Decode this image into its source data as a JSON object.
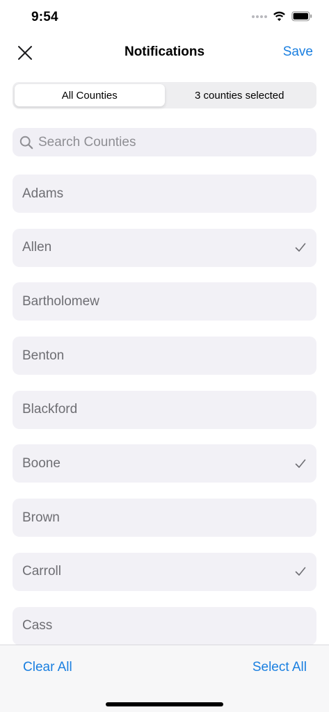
{
  "status_bar": {
    "time": "9:54"
  },
  "nav": {
    "title": "Notifications",
    "save_label": "Save"
  },
  "segmented": {
    "all_label": "All Counties",
    "selected_label": "3 counties selected",
    "active": "all"
  },
  "search": {
    "placeholder": "Search Counties",
    "value": ""
  },
  "counties": [
    {
      "name": "Adams",
      "checked": false
    },
    {
      "name": "Allen",
      "checked": true
    },
    {
      "name": "Bartholomew",
      "checked": false
    },
    {
      "name": "Benton",
      "checked": false
    },
    {
      "name": "Blackford",
      "checked": false
    },
    {
      "name": "Boone",
      "checked": true
    },
    {
      "name": "Brown",
      "checked": false
    },
    {
      "name": "Carroll",
      "checked": true
    },
    {
      "name": "Cass",
      "checked": false
    }
  ],
  "toolbar": {
    "clear_all_label": "Clear All",
    "select_all_label": "Select All"
  },
  "colors": {
    "accent": "#1a7fe0",
    "row_bg": "#f2f1f6",
    "row_text": "#6e6e73"
  },
  "icons": {
    "close": "close-icon",
    "search": "search-icon",
    "check": "checkmark-icon"
  }
}
